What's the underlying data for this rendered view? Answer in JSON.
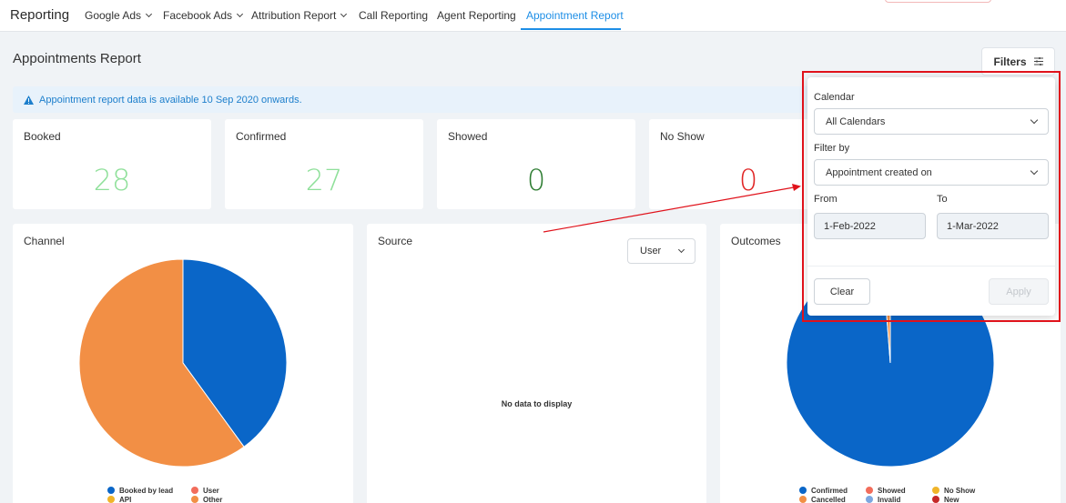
{
  "nav": {
    "brand": "Reporting",
    "items": [
      {
        "label": "Google Ads",
        "dropdown": true
      },
      {
        "label": "Facebook Ads",
        "dropdown": true
      },
      {
        "label": "Attribution Report",
        "dropdown": true
      },
      {
        "label": "Call Reporting",
        "dropdown": false
      },
      {
        "label": "Agent Reporting",
        "dropdown": false
      },
      {
        "label": "Appointment Report",
        "dropdown": false,
        "active": true
      }
    ]
  },
  "page": {
    "title": "Appointments Report",
    "filters_label": "Filters",
    "notice": "Appointment report data is available 10 Sep 2020 onwards."
  },
  "stats": [
    {
      "label": "Booked",
      "value": "28",
      "color": "#8fe09a"
    },
    {
      "label": "Confirmed",
      "value": "27",
      "color": "#8fe09a"
    },
    {
      "label": "Showed",
      "value": "0",
      "color": "#2e7d32"
    },
    {
      "label": "No Show",
      "value": "0",
      "color": "#e02424"
    }
  ],
  "panels": {
    "channel": {
      "title": "Channel"
    },
    "source": {
      "title": "Source",
      "select_value": "User",
      "empty_text": "No data to display"
    },
    "outcomes": {
      "title": "Outcomes"
    }
  },
  "chart_data": [
    {
      "type": "pie",
      "title": "Channel",
      "categories": [
        "Booked by lead",
        "User",
        "API",
        "Other"
      ],
      "values": [
        40,
        0,
        0,
        60
      ],
      "colors": [
        "#0a66c8",
        "#f26d5b",
        "#f0b429",
        "#f28f45"
      ]
    },
    {
      "type": "pie",
      "title": "Outcomes",
      "categories": [
        "Confirmed",
        "Showed",
        "No Show",
        "Cancelled",
        "Invalid",
        "New"
      ],
      "values": [
        98.8,
        0,
        0,
        1.2,
        0,
        0
      ],
      "colors": [
        "#0a66c8",
        "#f26d5b",
        "#f0b429",
        "#f28f45",
        "#7da7e0",
        "#c62828"
      ]
    }
  ],
  "legend_text": {
    "cancelled_display": "Cancelled",
    "invalid_display": "Invalid"
  },
  "filter_panel": {
    "calendar_label": "Calendar",
    "calendar_value": "All Calendars",
    "filter_by_label": "Filter by",
    "filter_by_value": "Appointment created on",
    "from_label": "From",
    "from_value": "1-Feb-2022",
    "to_label": "To",
    "to_value": "1-Mar-2022",
    "clear_label": "Clear",
    "apply_label": "Apply"
  }
}
